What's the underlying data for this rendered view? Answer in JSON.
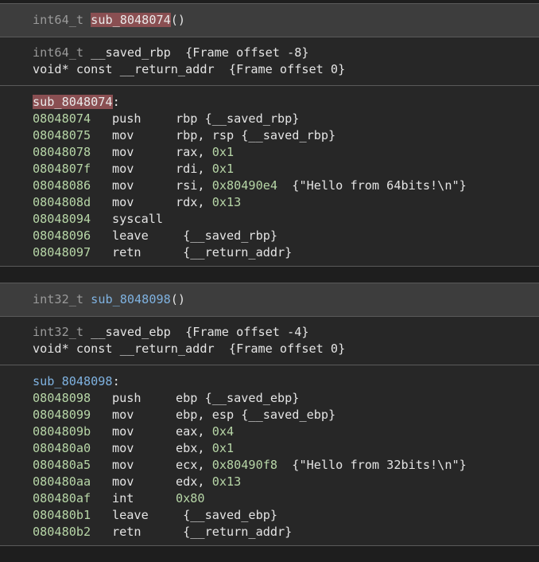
{
  "functions": [
    {
      "header": {
        "ret_type": "int64_t",
        "name": "sub_8048074",
        "parens": "()"
      },
      "vars": [
        {
          "type": "int64_t",
          "name": "__saved_rbp",
          "info": "{Frame offset -8}"
        },
        {
          "type": "void* const",
          "name": "__return_addr",
          "info": "{Frame offset 0}"
        }
      ],
      "label": "sub_8048074",
      "lines": [
        {
          "addr": "08048074",
          "mn": "push",
          "ops": "rbp {__saved_rbp}"
        },
        {
          "addr": "08048075",
          "mn": "mov",
          "ops": "rbp, rsp {__saved_rbp}"
        },
        {
          "addr": "08048078",
          "mn": "mov",
          "ops": "rax, 0x1"
        },
        {
          "addr": "0804807f",
          "mn": "mov",
          "ops": "rdi, 0x1"
        },
        {
          "addr": "08048086",
          "mn": "mov",
          "ops": "rsi, 0x80490e4  {\"Hello from 64bits!\\n\"}"
        },
        {
          "addr": "0804808d",
          "mn": "mov",
          "ops": "rdx, 0x13"
        },
        {
          "addr": "08048094",
          "mn": "syscall",
          "ops": ""
        },
        {
          "addr": "08048096",
          "mn": "leave",
          "ops": " {__saved_rbp}"
        },
        {
          "addr": "08048097",
          "mn": "retn",
          "ops": " {__return_addr}"
        }
      ]
    },
    {
      "header": {
        "ret_type": "int32_t",
        "name": "sub_8048098",
        "parens": "()"
      },
      "vars": [
        {
          "type": "int32_t",
          "name": "__saved_ebp",
          "info": "{Frame offset -4}"
        },
        {
          "type": "void* const",
          "name": "__return_addr",
          "info": "{Frame offset 0}"
        }
      ],
      "label": "sub_8048098",
      "lines": [
        {
          "addr": "08048098",
          "mn": "push",
          "ops": "ebp {__saved_ebp}"
        },
        {
          "addr": "08048099",
          "mn": "mov",
          "ops": "ebp, esp {__saved_ebp}"
        },
        {
          "addr": "0804809b",
          "mn": "mov",
          "ops": "eax, 0x4"
        },
        {
          "addr": "080480a0",
          "mn": "mov",
          "ops": "ebx, 0x1"
        },
        {
          "addr": "080480a5",
          "mn": "mov",
          "ops": "ecx, 0x80490f8  {\"Hello from 32bits!\\n\"}"
        },
        {
          "addr": "080480aa",
          "mn": "mov",
          "ops": "edx, 0x13"
        },
        {
          "addr": "080480af",
          "mn": "int",
          "ops": "0x80"
        },
        {
          "addr": "080480b1",
          "mn": "leave",
          "ops": " {__saved_ebp}"
        },
        {
          "addr": "080480b2",
          "mn": "retn",
          "ops": " {__return_addr}"
        }
      ]
    }
  ]
}
